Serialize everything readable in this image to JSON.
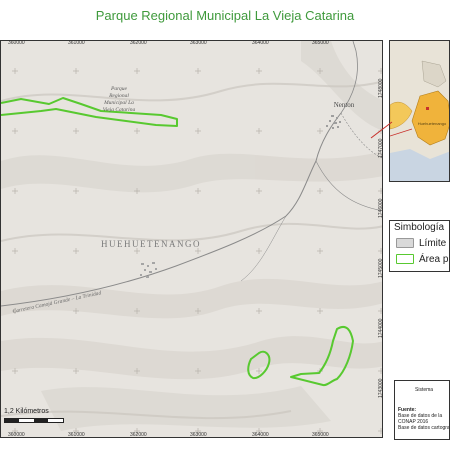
{
  "title": "Parque Regional Municipal La Vieja Catarina",
  "map": {
    "park_label_lines": [
      "Parque",
      "Regional",
      "Municipal La",
      "Vieja Catarina"
    ],
    "town_label": "Nenton",
    "department_label": "HUEHUETENANGO",
    "road_label": "Carretera Camojá Grande – La Trinidad",
    "x_ticks": [
      "360000",
      "361000",
      "362000",
      "363000",
      "364000",
      "365000"
    ],
    "y_ticks": [
      "1748000",
      "1747000",
      "1746000",
      "1745000",
      "1744000",
      "1743000"
    ],
    "colors": {
      "terrain": "#e7e4df",
      "protected_area_outline": "#58c930",
      "road": "#8a8a8a",
      "grid_cross": "#b7b2ab"
    }
  },
  "scale": {
    "label": "1,2 Kilómetros"
  },
  "legend": {
    "title": "Simbología",
    "items": [
      {
        "label": "Límite",
        "color": "#d9d9d9"
      },
      {
        "label": "Área pr",
        "color": "#ffffff",
        "outline": "#58c930"
      }
    ]
  },
  "sources": {
    "heading": "Sistema",
    "label": "Fuente:",
    "lines": [
      "Base de datos de la",
      "CONAP 2016",
      "Base de datos cartogra"
    ]
  },
  "locator": {
    "region_label": "Huehuetenango"
  }
}
